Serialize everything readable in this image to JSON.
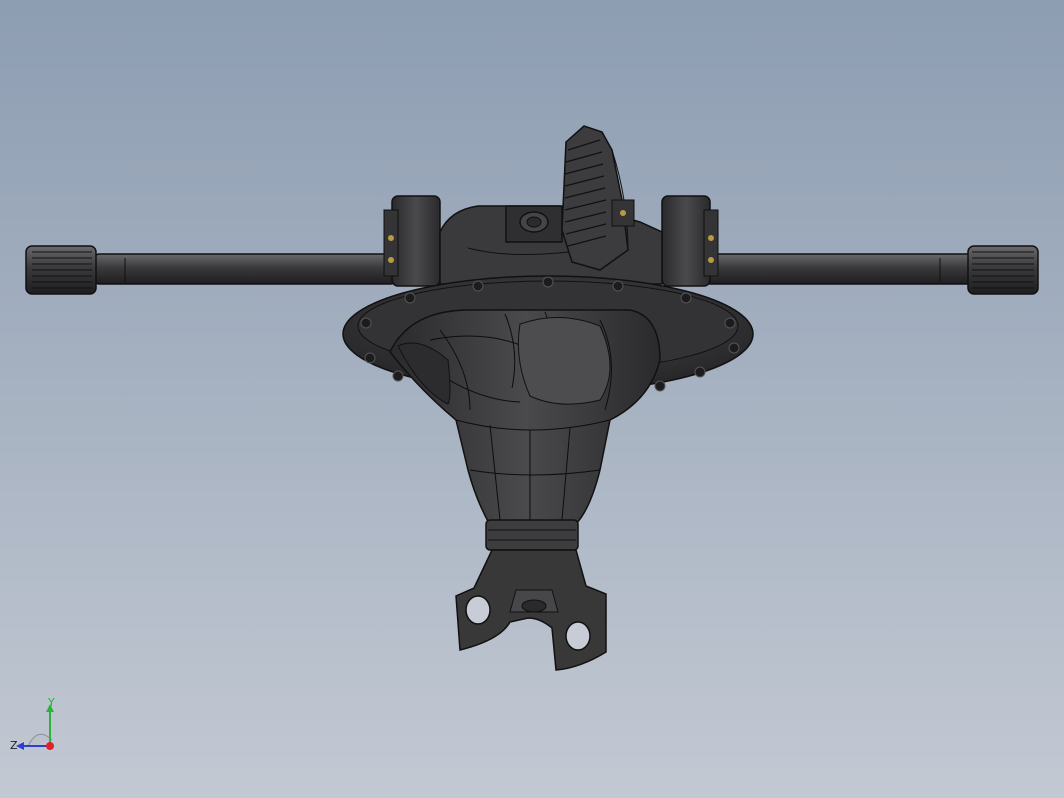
{
  "viewport": {
    "background_top": "#8d9db2",
    "background_bottom": "#c3c9d3",
    "model_color": "#3c3c3e",
    "edge_color": "#0f0f10"
  },
  "model": {
    "description_icon": "differential-axle-assembly"
  },
  "triad": {
    "x_color": "#e0202a",
    "y_color": "#29b33a",
    "z_color": "#2c3fd0",
    "y_label": "Y",
    "z_label": "Z"
  }
}
